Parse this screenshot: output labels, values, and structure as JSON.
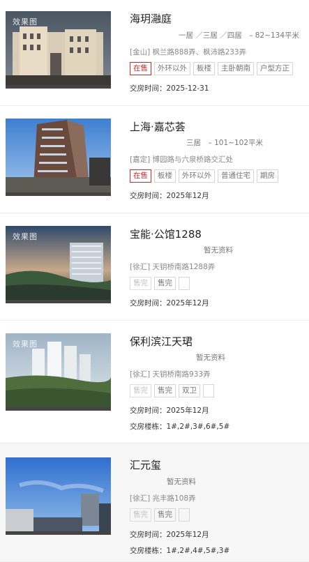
{
  "listings": [
    {
      "name": "海玥瀜庭",
      "watermark": "效果图",
      "spec": "一居 ／三居 ／四居　– 82~134平米",
      "address": "[金山] 枫兰路888弄、枫沛路233弄",
      "tags": [
        {
          "label": "在售",
          "style": "red"
        },
        {
          "label": "外环以外",
          "style": "normal"
        },
        {
          "label": "板楼",
          "style": "normal"
        },
        {
          "label": "主卧朝南",
          "style": "normal"
        },
        {
          "label": "户型方正",
          "style": "normal"
        }
      ],
      "delivery": "交房时间：2025-12-31"
    },
    {
      "name": "上海·嘉芯荟",
      "watermark": "",
      "spec": "三居　– 101~102平米",
      "address": "[嘉定] 博园路与六泉桥路交汇处",
      "tags": [
        {
          "label": "在售",
          "style": "red"
        },
        {
          "label": "板楼",
          "style": "normal"
        },
        {
          "label": "外环以外",
          "style": "normal"
        },
        {
          "label": "普通住宅",
          "style": "normal"
        },
        {
          "label": "期房",
          "style": "normal"
        }
      ],
      "delivery": "交房时间：2025年12月"
    },
    {
      "name": "宝能·公馆1288",
      "watermark": "效果图",
      "spec": "暂无资料",
      "address": "[徐汇] 天钥桥南路1288弄",
      "tags": [
        {
          "label": "售完",
          "style": "grey"
        },
        {
          "label": "售完",
          "style": "normal"
        },
        {
          "label": "",
          "style": "normal"
        }
      ],
      "delivery": "交房时间：2025年12月"
    },
    {
      "name": "保利滨江天珺",
      "watermark": "效果图",
      "spec": "暂无资料",
      "address": "[徐汇] 天钥桥南路933弄",
      "tags": [
        {
          "label": "售完",
          "style": "grey"
        },
        {
          "label": "售完",
          "style": "normal"
        },
        {
          "label": "双卫",
          "style": "normal"
        },
        {
          "label": "",
          "style": "normal"
        }
      ],
      "delivery": "交房时间：2025年12月",
      "buildings": "交房楼栋：1#,2#,3#,6#,5#"
    },
    {
      "name": "汇元玺",
      "watermark": "",
      "spec": "暂无资料",
      "address": "[徐汇] 兆丰路108弄",
      "tags": [
        {
          "label": "售完",
          "style": "grey"
        },
        {
          "label": "售完",
          "style": "normal"
        },
        {
          "label": "",
          "style": "normal"
        }
      ],
      "delivery": "交房时间：2025年12月",
      "buildings": "交房楼栋：1#,2#,4#,5#,3#"
    }
  ]
}
